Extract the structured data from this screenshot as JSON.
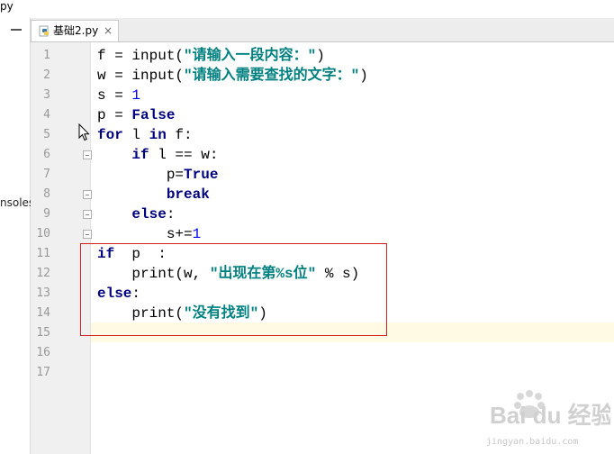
{
  "window": {
    "title_fragment": "py"
  },
  "left_panel": {
    "label": "nsoles"
  },
  "tabs": [
    {
      "label": "基础2.py",
      "close": "×",
      "icon": "python-file-icon"
    }
  ],
  "editor": {
    "line_numbers": [
      "1",
      "2",
      "3",
      "4",
      "5",
      "6",
      "7",
      "8",
      "9",
      "10",
      "11",
      "12",
      "13",
      "14",
      "15",
      "16",
      "17"
    ],
    "current_line": 15
  },
  "code": {
    "l1": {
      "a": "f = input(",
      "s": "\"请输入一段内容：\"",
      "b": ")"
    },
    "l2": {
      "a": "w = input(",
      "s": "\"请输入需要查找的文字：\"",
      "b": ")"
    },
    "l3": {
      "a": "s = ",
      "n": "1"
    },
    "l4": {
      "a": "p = ",
      "k": "False"
    },
    "l5": {
      "k1": "for",
      "a": " l ",
      "k2": "in",
      "b": " f:"
    },
    "l6": {
      "i": "    ",
      "k": "if",
      "a": " l == w:"
    },
    "l7": {
      "i": "        p=",
      "k": "True"
    },
    "l8": {
      "i": "        ",
      "k": "break"
    },
    "l9": {
      "i": "    ",
      "k": "else",
      "a": ":"
    },
    "l10": {
      "i": "        s+=",
      "n": "1"
    },
    "l11": {
      "k": "if",
      "a": "  p  :"
    },
    "l12": {
      "i": "    print(w, ",
      "s": "\"出现在第%s位\"",
      "b": " % s)"
    },
    "l13": {
      "k": "else",
      "a": ":"
    },
    "l14": {
      "i": "    print(",
      "s": "\"没有找到\"",
      "b": ")"
    }
  },
  "watermark": {
    "brand": "Bai du 经验",
    "url": "jingyan.baidu.com"
  },
  "colors": {
    "keyword": "#000080",
    "string": "#008080",
    "number": "#0000ff",
    "highlight_box": "#d42020",
    "current_line": "#fffae3"
  }
}
